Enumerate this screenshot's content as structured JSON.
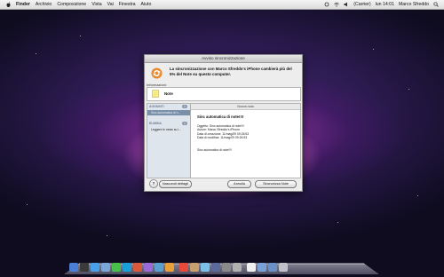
{
  "menubar": {
    "items": [
      "Finder",
      "Archivio",
      "Composizione",
      "Vista",
      "Vai",
      "Finestra",
      "Aiuto"
    ],
    "status": {
      "carrier": "(Carrier)",
      "clock": "lun 14:01",
      "user": "Marco Sfreddo"
    }
  },
  "dialog": {
    "title": "Avviso sincronizzazione",
    "message": "La sincronizzazione con Marco Sfreddo's iPhone cambierà più del 5% del Note su questo computer.",
    "info_label": "Informazioni:",
    "info_item": "Note",
    "sidebar": {
      "section_added": "AGGIUNTI",
      "count_added": "1",
      "selected_item": "Sinc automatica di n...",
      "section_deleted": "ELIMINA",
      "count_deleted": "1",
      "deleted_item": "Leggere le news su i..."
    },
    "content": {
      "header": "Nuova nota",
      "note_title": "Sinc automatica di note!!!!",
      "meta": [
        "Oggetto: Sinc automatica di note!!!!",
        "Autore: Marco Sfreddo's iPhone",
        "Data di creazione: 11/mag/09 09:26:53",
        "Data di modifica: 11/mag/09 09:26:53"
      ],
      "body": "Sinc automatica di note!!!!"
    },
    "buttons": {
      "help": "?",
      "hide": "Nascondi dettagli",
      "cancel": "Annulla",
      "sync": "Sincronizza Note"
    }
  },
  "dock": {
    "icons": [
      "finder-icon",
      "dashboard-icon",
      "safari-icon",
      "mail-icon",
      "ichat-icon",
      "skype-icon",
      "photo-icon",
      "itunes-icon",
      "iphoto-icon",
      "app-icon",
      "calendar-icon",
      "address-book-icon",
      "preview-icon",
      "xcode-icon",
      "settings-icon",
      "utility-icon",
      "textedit-icon",
      "folder-icon",
      "downloads-icon",
      "trash-icon"
    ],
    "colors": [
      "#4a7fd6",
      "#3a3a3a",
      "#4aa0e8",
      "#7aa6d8",
      "#4ac04a",
      "#1a9fd8",
      "#d85a3a",
      "#9a6ad8",
      "#5aa0d0",
      "#e8a03a",
      "#e84a3a",
      "#c8a070",
      "#7ac0e8",
      "#5a6a9a",
      "#8a8a8a",
      "#b0b0b0",
      "#f0f0f0",
      "#7aa0d8",
      "#6a90c8",
      "#c0c0c8"
    ]
  }
}
